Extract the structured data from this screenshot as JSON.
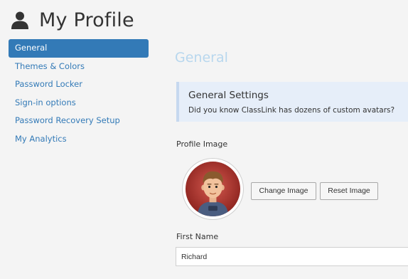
{
  "header": {
    "title": "My Profile",
    "icon": "user-icon"
  },
  "sidebar": {
    "items": [
      {
        "label": "General",
        "active": true
      },
      {
        "label": "Themes & Colors",
        "active": false
      },
      {
        "label": "Password Locker",
        "active": false
      },
      {
        "label": "Sign-in options",
        "active": false
      },
      {
        "label": "Password Recovery Setup",
        "active": false
      },
      {
        "label": "My Analytics",
        "active": false
      }
    ]
  },
  "main": {
    "section_title": "General",
    "info_box": {
      "title": "General Settings",
      "text": "Did you know ClassLink has dozens of custom avatars?"
    },
    "profile_image_label": "Profile Image",
    "change_image_label": "Change Image",
    "reset_image_label": "Reset Image",
    "first_name_label": "First Name",
    "first_name_value": "Richard"
  },
  "colors": {
    "accent": "#337ab7",
    "section_title": "#b8d7ee",
    "info_box_bg": "#e6eef9",
    "avatar_ring": "#a8322c"
  }
}
